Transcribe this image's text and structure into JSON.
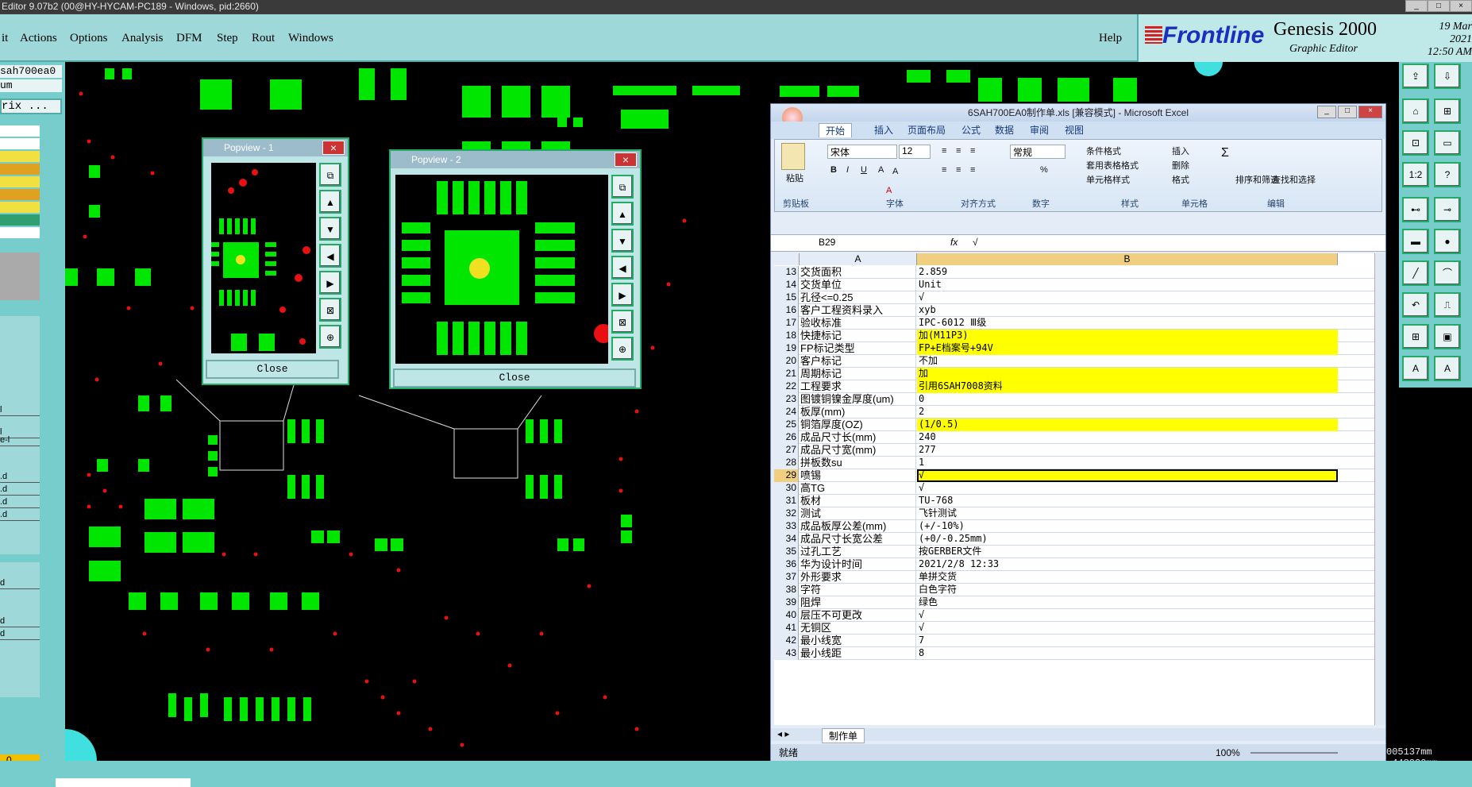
{
  "window_title": "Editor 9.07b2 (00@HY-HYCAM-PC189 - Windows, pid:2660)",
  "menu": [
    "it",
    "Actions",
    "Options",
    "Analysis",
    "DFM",
    "Step",
    "Rout",
    "Windows"
  ],
  "help": "Help",
  "brand": {
    "logo": "Frontline",
    "product": "Genesis 2000",
    "subtitle": "Graphic Editor",
    "date": "19 Mar 2021",
    "time": "12:50 AM"
  },
  "left_panel": {
    "job": "sah700ea0",
    "unit": "um",
    "matrix": "rix ...",
    "value": "0",
    "rows": [
      "l",
      "l",
      "e-l",
      ".d",
      ".d",
      ".d",
      ".d",
      "d",
      "d",
      "d"
    ]
  },
  "right_readout": {
    "x": "005137mm",
    "y": ".448220mm"
  },
  "popview1": {
    "title": "Popview - 1",
    "close": "Close"
  },
  "popview2": {
    "title": "Popview - 2",
    "close": "Close"
  },
  "excel": {
    "title": "6SAH700EA0制作单.xls  [兼容模式] - Microsoft Excel",
    "tabs": [
      "开始",
      "插入",
      "页面布局",
      "公式",
      "数据",
      "审阅",
      "视图"
    ],
    "ribbon": {
      "paste": "粘贴",
      "font": "宋体",
      "size": "12",
      "number_fmt": "常规",
      "cond_fmt": "条件格式",
      "table_fmt": "套用表格格式",
      "cell_style": "单元格样式",
      "insert": "插入",
      "delete": "删除",
      "format": "格式",
      "sort": "排序和筛选",
      "find": "查找和选择",
      "groups": [
        "剪贴板",
        "字体",
        "对齐方式",
        "数字",
        "样式",
        "单元格",
        "编辑"
      ]
    },
    "name_box": "B29",
    "formula": "√",
    "col_a": "A",
    "col_b": "B",
    "rows": [
      {
        "n": "13",
        "a": "交货面积",
        "b": "2.859",
        "hl": false
      },
      {
        "n": "14",
        "a": "交货单位",
        "b": "Unit",
        "hl": false
      },
      {
        "n": "15",
        "a": "孔径<=0.25",
        "b": "√",
        "hl": false
      },
      {
        "n": "16",
        "a": "客户工程资料录入",
        "b": "xyb",
        "hl": false
      },
      {
        "n": "17",
        "a": "验收标准",
        "b": "IPC-6012 Ⅲ级",
        "hl": false
      },
      {
        "n": "18",
        "a": "快捷标记",
        "b": "加(M11P3)",
        "hl": true
      },
      {
        "n": "19",
        "a": "FP标记类型",
        "b": "FP+E档案号+94V",
        "hl": true
      },
      {
        "n": "20",
        "a": "客户标记",
        "b": "不加",
        "hl": false
      },
      {
        "n": "21",
        "a": "周期标记",
        "b": "加",
        "hl": true
      },
      {
        "n": "22",
        "a": "工程要求",
        "b": "引用6SAH7008资料",
        "hl": true
      },
      {
        "n": "23",
        "a": "图镀铜镍金厚度(um)",
        "b": "0",
        "hl": false
      },
      {
        "n": "24",
        "a": "板厚(mm)",
        "b": "2",
        "hl": false
      },
      {
        "n": "25",
        "a": "铜箔厚度(OZ)",
        "b": "(1/0.5)",
        "hl": true
      },
      {
        "n": "26",
        "a": "成品尺寸长(mm)",
        "b": "240",
        "hl": false
      },
      {
        "n": "27",
        "a": "成品尺寸宽(mm)",
        "b": "277",
        "hl": false
      },
      {
        "n": "28",
        "a": "拼板数su",
        "b": "1",
        "hl": false
      },
      {
        "n": "29",
        "a": "喷锡",
        "b": "√",
        "hl": true
      },
      {
        "n": "30",
        "a": "高TG",
        "b": "√",
        "hl": false
      },
      {
        "n": "31",
        "a": "板材",
        "b": "TU-768",
        "hl": false
      },
      {
        "n": "32",
        "a": "测试",
        "b": "飞针测试",
        "hl": false
      },
      {
        "n": "33",
        "a": "成品板厚公差(mm)",
        "b": "(+/-10%)",
        "hl": false
      },
      {
        "n": "34",
        "a": "成品尺寸长宽公差",
        "b": "(+0/-0.25mm)",
        "hl": false
      },
      {
        "n": "35",
        "a": "过孔工艺",
        "b": "按GERBER文件",
        "hl": false
      },
      {
        "n": "36",
        "a": "华为设计时间",
        "b": "2021/2/8 12:33",
        "hl": false
      },
      {
        "n": "37",
        "a": "外形要求",
        "b": "单拼交货",
        "hl": false
      },
      {
        "n": "38",
        "a": "字符",
        "b": "白色字符",
        "hl": false
      },
      {
        "n": "39",
        "a": "阻焊",
        "b": "绿色",
        "hl": false
      },
      {
        "n": "40",
        "a": "层压不可更改",
        "b": "√",
        "hl": false
      },
      {
        "n": "41",
        "a": "无铜区",
        "b": "√",
        "hl": false
      },
      {
        "n": "42",
        "a": "最小线宽",
        "b": "7",
        "hl": false
      },
      {
        "n": "43",
        "a": "最小线距",
        "b": "8",
        "hl": false
      }
    ],
    "sheet": "制作单",
    "status": "就绪",
    "zoom": "100%"
  }
}
